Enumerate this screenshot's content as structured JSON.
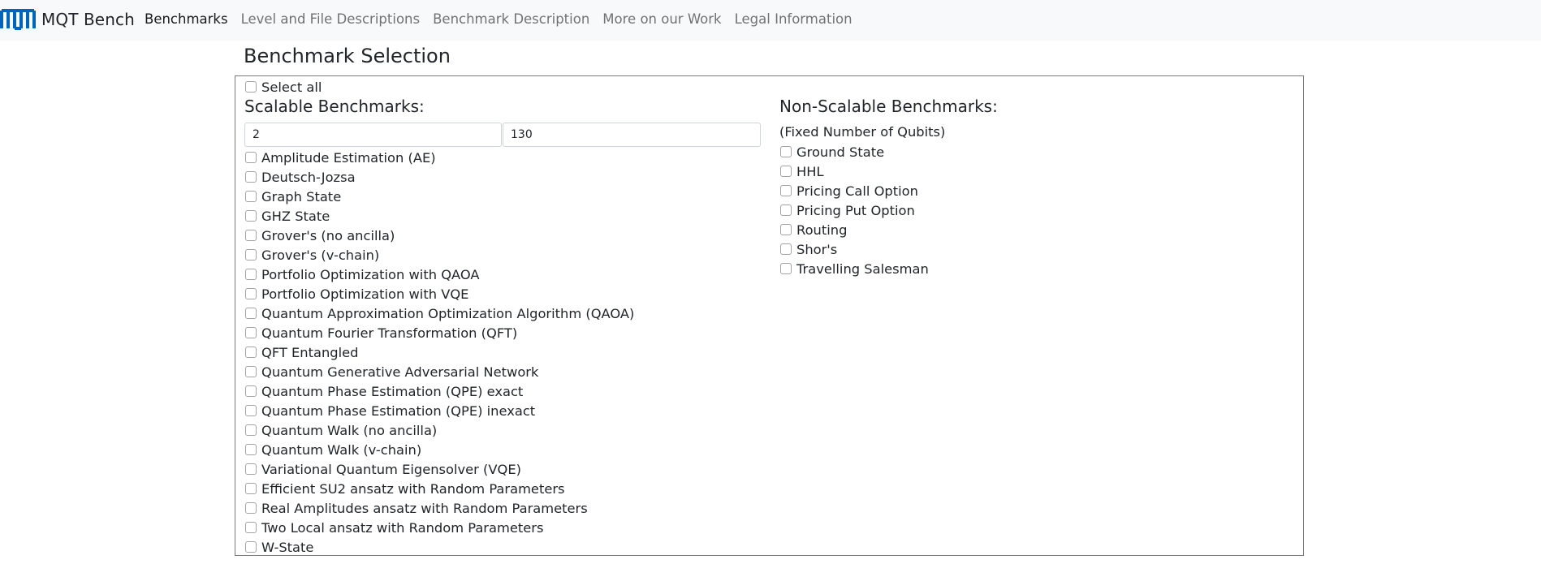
{
  "navbar": {
    "brand": "MQT Bench",
    "links": [
      {
        "label": "Benchmarks",
        "active": true
      },
      {
        "label": "Level and File Descriptions",
        "active": false
      },
      {
        "label": "Benchmark Description",
        "active": false
      },
      {
        "label": "More on our Work",
        "active": false
      },
      {
        "label": "Legal Information",
        "active": false
      }
    ]
  },
  "page_title": "Benchmark Selection",
  "select_all_label": "Select all",
  "scalable": {
    "title": "Scalable Benchmarks:",
    "min_qubits": "2",
    "max_qubits": "130",
    "items": [
      "Amplitude Estimation (AE)",
      "Deutsch-Jozsa",
      "Graph State",
      "GHZ State",
      "Grover's (no ancilla)",
      "Grover's (v-chain)",
      "Portfolio Optimization with QAOA",
      "Portfolio Optimization with VQE",
      "Quantum Approximation Optimization Algorithm (QAOA)",
      "Quantum Fourier Transformation (QFT)",
      "QFT Entangled",
      "Quantum Generative Adversarial Network",
      "Quantum Phase Estimation (QPE) exact",
      "Quantum Phase Estimation (QPE) inexact",
      "Quantum Walk (no ancilla)",
      "Quantum Walk (v-chain)",
      "Variational Quantum Eigensolver (VQE)",
      "Efficient SU2 ansatz with Random Parameters",
      "Real Amplitudes ansatz with Random Parameters",
      "Two Local ansatz with Random Parameters",
      "W-State"
    ]
  },
  "non_scalable": {
    "title": "Non-Scalable Benchmarks:",
    "note": "(Fixed Number of Qubits)",
    "items": [
      "Ground State",
      "HHL",
      "Pricing Call Option",
      "Pricing Put Option",
      "Routing",
      "Shor's",
      "Travelling Salesman"
    ]
  },
  "colors": {
    "navbar_bg": "#f8f9fa",
    "logo_blue": "#0065bd",
    "panel_border": "#7a7a7a"
  }
}
